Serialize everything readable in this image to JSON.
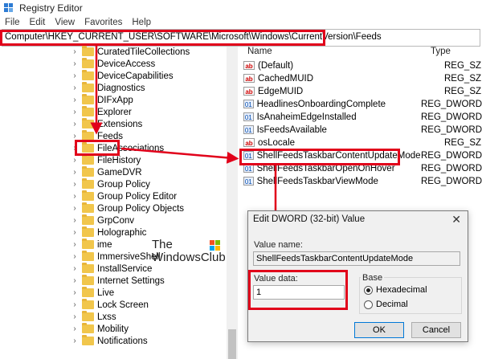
{
  "window": {
    "title": "Registry Editor"
  },
  "menu": [
    "File",
    "Edit",
    "View",
    "Favorites",
    "Help"
  ],
  "address": "Computer\\HKEY_CURRENT_USER\\SOFTWARE\\Microsoft\\Windows\\CurrentVersion\\Feeds",
  "tree": [
    "CuratedTileCollections",
    "DeviceAccess",
    "DeviceCapabilities",
    "Diagnostics",
    "DIFxApp",
    "Explorer",
    "Extensions",
    "Feeds",
    "FileAssociations",
    "FileHistory",
    "GameDVR",
    "Group Policy",
    "Group Policy Editor",
    "Group Policy Objects",
    "GrpConv",
    "Holographic",
    "ime",
    "ImmersiveShell",
    "InstallService",
    "Internet Settings",
    "Live",
    "Lock Screen",
    "Lxss",
    "Mobility",
    "Notifications"
  ],
  "values_header": {
    "name": "Name",
    "type": "Type"
  },
  "values": [
    {
      "name": "(Default)",
      "type": "REG_SZ",
      "icon": "string-value-icon"
    },
    {
      "name": "CachedMUID",
      "type": "REG_SZ",
      "icon": "string-value-icon"
    },
    {
      "name": "EdgeMUID",
      "type": "REG_SZ",
      "icon": "string-value-icon"
    },
    {
      "name": "HeadlinesOnboardingComplete",
      "type": "REG_DWORD",
      "icon": "binary-value-icon"
    },
    {
      "name": "IsAnaheimEdgeInstalled",
      "type": "REG_DWORD",
      "icon": "binary-value-icon"
    },
    {
      "name": "IsFeedsAvailable",
      "type": "REG_DWORD",
      "icon": "binary-value-icon"
    },
    {
      "name": "osLocale",
      "type": "REG_SZ",
      "icon": "string-value-icon"
    },
    {
      "name": "ShellFeedsTaskbarContentUpdateMode",
      "type": "REG_DWORD",
      "icon": "binary-value-icon"
    },
    {
      "name": "ShellFeedsTaskbarOpenOnHover",
      "type": "REG_DWORD",
      "icon": "binary-value-icon"
    },
    {
      "name": "ShellFeedsTaskbarViewMode",
      "type": "REG_DWORD",
      "icon": "binary-value-icon"
    }
  ],
  "dialog": {
    "title": "Edit DWORD (32-bit) Value",
    "value_name_label": "Value name:",
    "value_name": "ShellFeedsTaskbarContentUpdateMode",
    "value_data_label": "Value data:",
    "value_data": "1",
    "base_label": "Base",
    "hex_label": "Hexadecimal",
    "dec_label": "Decimal",
    "ok": "OK",
    "cancel": "Cancel"
  },
  "logo": {
    "line1": "The",
    "line2": "WindowsClub"
  },
  "colors": {
    "highlight": "#e1001a",
    "folder": "#f1c64c"
  }
}
